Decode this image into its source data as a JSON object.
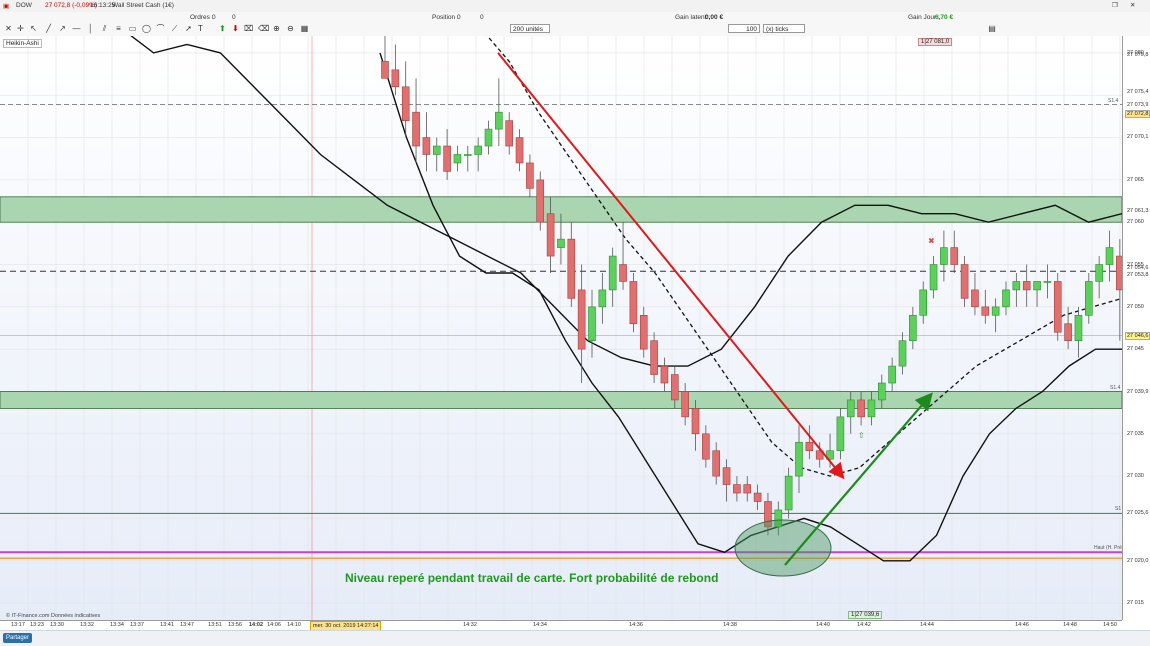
{
  "titlebar": {
    "symbol": "DOW",
    "price": "27 072,8 (-0,09%)",
    "time": "16:13:25",
    "instrument": "Wall Street Cash (1€)"
  },
  "toolbar": {
    "orders_label": "Ordres :",
    "orders_value": "0",
    "orders_value2": "0",
    "position_label": "Position :",
    "position_value": "0",
    "position_value2": "0",
    "gain_latent_label": "Gain latent :",
    "gain_latent_value": "0,00 €",
    "gain_jour_label": "Gain Jour :",
    "gain_jour_value": "6,70 €",
    "units": "200 unités",
    "ticks_value": "100",
    "ticks_label": "(x) ticks"
  },
  "chart": {
    "indicator_label": "Heikin-Ashi",
    "provider": "© IT-Finance.com Données indicatives",
    "annotation": "Niveau reperé pendant travail de carte. Fort probabilité de rebond",
    "top_badge": "1|27 081,0",
    "bottom_badge": "1|27 039,6",
    "date_badge": "mer. 30 oct. 2019 14:27:14",
    "share_label": "Partager",
    "s1_label": "S1",
    "s1b_label": "S1.4",
    "s2_label": "S1.4",
    "haut_label": "Haut (H. Pré)",
    "colors": {
      "green_zone": "#a9d5b0",
      "bull": "#5ccf5c",
      "bear": "#e07070",
      "trend_red": "#e0191b",
      "trend_green": "#1e8a1e",
      "pivot_magenta": "#c93fd6",
      "pivot_orange": "#f0a34a"
    }
  },
  "price_axis": {
    "labels": [
      "27 080",
      "27 079,8",
      "27 075,4",
      "27 073,9",
      "27 072,8",
      "27 070,1",
      "27 065",
      "27 061,3",
      "27 060",
      "27 055",
      "27 054,6",
      "27 053,8",
      "27 050",
      "27 046,6",
      "27 045",
      "27 039,9",
      "27 035",
      "27 030",
      "27 025,6",
      "27 020,0",
      "27 015"
    ],
    "tag_current": "27 072,8",
    "tag_yellow": "27 046,6"
  },
  "time_axis": {
    "labels": [
      "13:17",
      "13:23",
      "13:30",
      "13:32",
      "13:34",
      "13:37",
      "13:41",
      "13:47",
      "13:51",
      "13:56",
      "14:02",
      "14:06",
      "14:10",
      "14:32",
      "14:34",
      "14:36",
      "14:38",
      "14:40",
      "14:42",
      "14:44",
      "14:46",
      "14:48",
      "14:50"
    ]
  },
  "chart_data": {
    "type": "candlestick",
    "chart_kind": "Heikin-Ashi",
    "ylim": [
      27013,
      27082
    ],
    "bands": [
      [
        27060,
        27063
      ],
      [
        27038,
        27040
      ]
    ],
    "lines": {
      "s1": 27025.6,
      "s2": 27073.9,
      "pivot_magenta": 27021.0,
      "pivot_orange": 27020.3,
      "dashed_mid": 27054.2,
      "red_thin": 27046.6
    },
    "candles": [
      {
        "o": 27079,
        "h": 27082,
        "l": 27077,
        "c": 27077,
        "bull": false
      },
      {
        "o": 27078,
        "h": 27081,
        "l": 27075,
        "c": 27076,
        "bull": false
      },
      {
        "o": 27076,
        "h": 27079,
        "l": 27070,
        "c": 27072,
        "bull": false
      },
      {
        "o": 27073,
        "h": 27077,
        "l": 27067,
        "c": 27069,
        "bull": false
      },
      {
        "o": 27070,
        "h": 27073,
        "l": 27066,
        "c": 27068,
        "bull": false
      },
      {
        "o": 27068,
        "h": 27070,
        "l": 27066,
        "c": 27069,
        "bull": true
      },
      {
        "o": 27069,
        "h": 27071,
        "l": 27065,
        "c": 27066,
        "bull": false
      },
      {
        "o": 27067,
        "h": 27069,
        "l": 27066,
        "c": 27068,
        "bull": true
      },
      {
        "o": 27068,
        "h": 27069,
        "l": 27066,
        "c": 27068,
        "bull": true
      },
      {
        "o": 27068,
        "h": 27070,
        "l": 27066,
        "c": 27069,
        "bull": true
      },
      {
        "o": 27069,
        "h": 27072,
        "l": 27068,
        "c": 27071,
        "bull": true
      },
      {
        "o": 27071,
        "h": 27077,
        "l": 27069,
        "c": 27073,
        "bull": true
      },
      {
        "o": 27072,
        "h": 27073,
        "l": 27068,
        "c": 27069,
        "bull": false
      },
      {
        "o": 27070,
        "h": 27071,
        "l": 27066,
        "c": 27067,
        "bull": false
      },
      {
        "o": 27067,
        "h": 27068,
        "l": 27063,
        "c": 27064,
        "bull": false
      },
      {
        "o": 27065,
        "h": 27066,
        "l": 27059,
        "c": 27060,
        "bull": false
      },
      {
        "o": 27061,
        "h": 27063,
        "l": 27054,
        "c": 27056,
        "bull": false
      },
      {
        "o": 27057,
        "h": 27061,
        "l": 27055,
        "c": 27058,
        "bull": true
      },
      {
        "o": 27058,
        "h": 27060,
        "l": 27050,
        "c": 27051,
        "bull": false
      },
      {
        "o": 27052,
        "h": 27055,
        "l": 27041,
        "c": 27045,
        "bull": false
      },
      {
        "o": 27046,
        "h": 27052,
        "l": 27044,
        "c": 27050,
        "bull": true
      },
      {
        "o": 27050,
        "h": 27054,
        "l": 27048,
        "c": 27052,
        "bull": true
      },
      {
        "o": 27052,
        "h": 27057,
        "l": 27050,
        "c": 27056,
        "bull": true
      },
      {
        "o": 27055,
        "h": 27060,
        "l": 27052,
        "c": 27053,
        "bull": false
      },
      {
        "o": 27053,
        "h": 27054,
        "l": 27047,
        "c": 27048,
        "bull": false
      },
      {
        "o": 27049,
        "h": 27050,
        "l": 27044,
        "c": 27045,
        "bull": false
      },
      {
        "o": 27046,
        "h": 27047,
        "l": 27041,
        "c": 27042,
        "bull": false
      },
      {
        "o": 27043,
        "h": 27044,
        "l": 27040,
        "c": 27041,
        "bull": false
      },
      {
        "o": 27042,
        "h": 27043,
        "l": 27038,
        "c": 27039,
        "bull": false
      },
      {
        "o": 27040,
        "h": 27041,
        "l": 27036,
        "c": 27037,
        "bull": false
      },
      {
        "o": 27038,
        "h": 27039,
        "l": 27033,
        "c": 27035,
        "bull": false
      },
      {
        "o": 27035,
        "h": 27036,
        "l": 27031,
        "c": 27032,
        "bull": false
      },
      {
        "o": 27033,
        "h": 27034,
        "l": 27029,
        "c": 27030,
        "bull": false
      },
      {
        "o": 27031,
        "h": 27032,
        "l": 27027,
        "c": 27029,
        "bull": false
      },
      {
        "o": 27029,
        "h": 27030,
        "l": 27027,
        "c": 27028,
        "bull": false
      },
      {
        "o": 27029,
        "h": 27030,
        "l": 27027,
        "c": 27028,
        "bull": false
      },
      {
        "o": 27028,
        "h": 27029,
        "l": 27026,
        "c": 27027,
        "bull": false
      },
      {
        "o": 27027,
        "h": 27028,
        "l": 27023,
        "c": 27024,
        "bull": false
      },
      {
        "o": 27024,
        "h": 27027,
        "l": 27023,
        "c": 27026,
        "bull": true
      },
      {
        "o": 27026,
        "h": 27031,
        "l": 27025,
        "c": 27030,
        "bull": true
      },
      {
        "o": 27030,
        "h": 27036,
        "l": 27028,
        "c": 27034,
        "bull": true
      },
      {
        "o": 27034,
        "h": 27036,
        "l": 27032,
        "c": 27033,
        "bull": false
      },
      {
        "o": 27033,
        "h": 27034,
        "l": 27031,
        "c": 27032,
        "bull": false
      },
      {
        "o": 27032,
        "h": 27035,
        "l": 27031,
        "c": 27033,
        "bull": true
      },
      {
        "o": 27033,
        "h": 27038,
        "l": 27032,
        "c": 27037,
        "bull": true
      },
      {
        "o": 27037,
        "h": 27040,
        "l": 27035,
        "c": 27039,
        "bull": true
      },
      {
        "o": 27039,
        "h": 27040,
        "l": 27036,
        "c": 27037,
        "bull": false
      },
      {
        "o": 27037,
        "h": 27040,
        "l": 27036,
        "c": 27039,
        "bull": true
      },
      {
        "o": 27039,
        "h": 27042,
        "l": 27038,
        "c": 27041,
        "bull": true
      },
      {
        "o": 27041,
        "h": 27044,
        "l": 27040,
        "c": 27043,
        "bull": true
      },
      {
        "o": 27043,
        "h": 27047,
        "l": 27042,
        "c": 27046,
        "bull": true
      },
      {
        "o": 27046,
        "h": 27050,
        "l": 27045,
        "c": 27049,
        "bull": true
      },
      {
        "o": 27049,
        "h": 27053,
        "l": 27048,
        "c": 27052,
        "bull": true
      },
      {
        "o": 27052,
        "h": 27056,
        "l": 27051,
        "c": 27055,
        "bull": true
      },
      {
        "o": 27055,
        "h": 27059,
        "l": 27053,
        "c": 27057,
        "bull": true
      },
      {
        "o": 27057,
        "h": 27059,
        "l": 27054,
        "c": 27055,
        "bull": false
      },
      {
        "o": 27055,
        "h": 27056,
        "l": 27050,
        "c": 27051,
        "bull": false
      },
      {
        "o": 27052,
        "h": 27054,
        "l": 27049,
        "c": 27050,
        "bull": false
      },
      {
        "o": 27050,
        "h": 27052,
        "l": 27048,
        "c": 27049,
        "bull": false
      },
      {
        "o": 27049,
        "h": 27051,
        "l": 27047,
        "c": 27050,
        "bull": true
      },
      {
        "o": 27050,
        "h": 27053,
        "l": 27049,
        "c": 27052,
        "bull": true
      },
      {
        "o": 27052,
        "h": 27054,
        "l": 27050,
        "c": 27053,
        "bull": true
      },
      {
        "o": 27053,
        "h": 27055,
        "l": 27050,
        "c": 27052,
        "bull": false
      },
      {
        "o": 27052,
        "h": 27053,
        "l": 27050,
        "c": 27053,
        "bull": true
      },
      {
        "o": 27053,
        "h": 27055,
        "l": 27051,
        "c": 27053,
        "bull": true
      },
      {
        "o": 27053,
        "h": 27054,
        "l": 27046,
        "c": 27047,
        "bull": false
      },
      {
        "o": 27048,
        "h": 27050,
        "l": 27045,
        "c": 27046,
        "bull": false
      },
      {
        "o": 27046,
        "h": 27050,
        "l": 27044,
        "c": 27049,
        "bull": true
      },
      {
        "o": 27049,
        "h": 27054,
        "l": 27048,
        "c": 27053,
        "bull": true
      },
      {
        "o": 27053,
        "h": 27056,
        "l": 27051,
        "c": 27055,
        "bull": true
      },
      {
        "o": 27055,
        "h": 27059,
        "l": 27053,
        "c": 27057,
        "bull": true
      },
      {
        "o": 27056,
        "h": 27058,
        "l": 27046,
        "c": 27052,
        "bull": false
      }
    ],
    "upper_band": [
      27100,
      27095,
      27088,
      27083,
      27080,
      27081,
      27080,
      27076,
      27072,
      27068,
      27065,
      27062,
      27060,
      27058,
      27056,
      27054,
      27050,
      27046,
      27044,
      27043,
      27043,
      27045,
      27050,
      27056,
      27060,
      27062,
      27062,
      27061,
      27061,
      27060,
      27061,
      27062,
      27060,
      27061
    ],
    "lower_band": [
      27080,
      27070,
      27062,
      27056,
      27054,
      27054,
      27052,
      27046,
      27041,
      27037,
      27032,
      27027,
      27022,
      27021,
      27023,
      27024,
      27025,
      27024,
      27022,
      27020,
      27020,
      27023,
      27030,
      27035,
      27038,
      27040,
      27043,
      27045,
      27045
    ]
  }
}
